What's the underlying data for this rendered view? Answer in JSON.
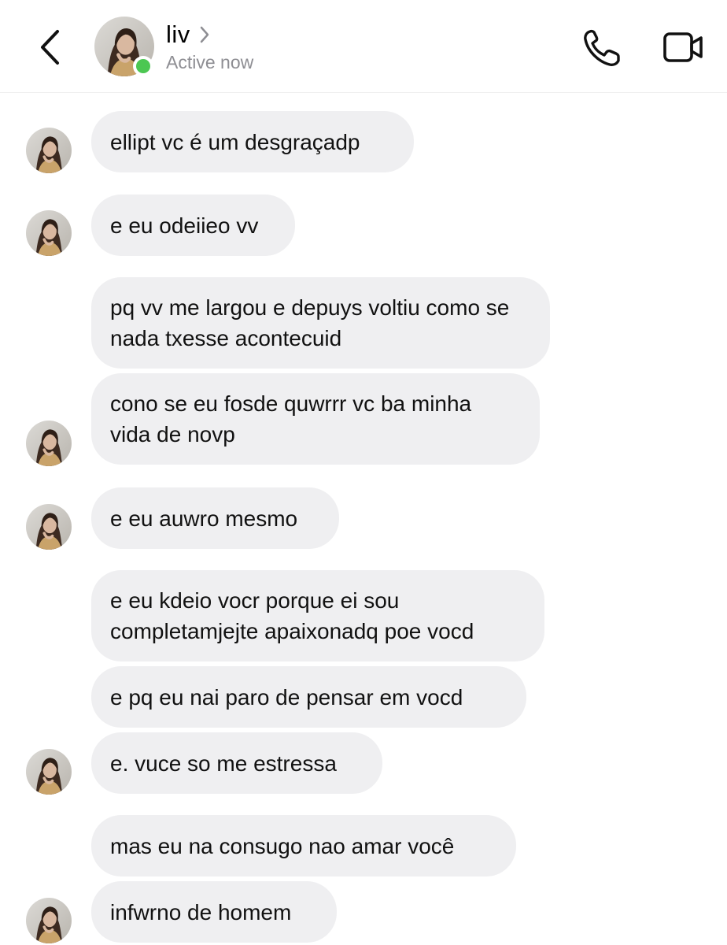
{
  "header": {
    "contact_name": "liv",
    "status": "Active now",
    "icons": {
      "back": "chevron-left-icon",
      "name_chevron": "chevron-right-icon",
      "call": "phone-icon",
      "video": "video-camera-icon"
    },
    "online_color": "#4cc752"
  },
  "colors": {
    "bubble_bg": "#efeff1",
    "status_gray": "#8e8e93"
  },
  "messages": [
    {
      "text": "ellipt vc é um desgraçadp"
    },
    {
      "text": "e eu odeiieo vv"
    },
    {
      "text": "pq vv me largou e depuys voltiu como se\nnada txesse acontecuid"
    },
    {
      "text": "cono se eu fosde quwrrr vc ba minha\nvida de novp"
    },
    {
      "text": "e eu auwro mesmo"
    },
    {
      "text": "e eu kdeio vocr porque ei sou\ncompletamjejte apaixonadq poe vocd"
    },
    {
      "text": "e pq eu nai paro de pensar em vocd"
    },
    {
      "text": "e. vuce so me estressa"
    },
    {
      "text": "mas eu na consugo nao amar você"
    },
    {
      "text": "infwrno de homem"
    }
  ]
}
